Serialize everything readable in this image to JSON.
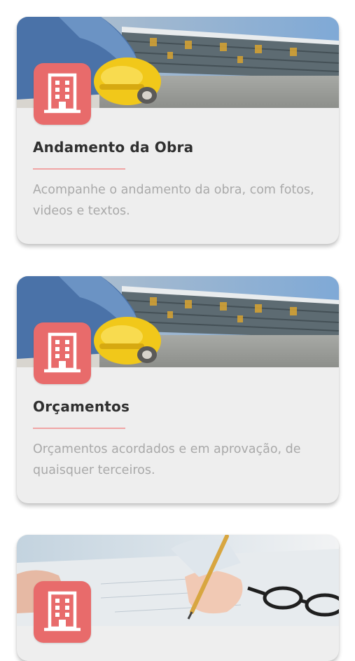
{
  "cards": [
    {
      "title": "Andamento da Obra",
      "description": "Acompanhe o andamento da obra, com fotos, videos e textos.",
      "image": "construction-worker-helmet-photo",
      "icon": "building-icon"
    },
    {
      "title": "Orçamentos",
      "description": "Orçamentos acordados e em aprovação, de quaisquer terceiros.",
      "image": "construction-worker-helmet-photo",
      "icon": "building-icon"
    },
    {
      "title": "",
      "description": "",
      "image": "hand-writing-on-blueprint-photo",
      "icon": "building-icon"
    }
  ],
  "colors": {
    "accent": "#e86b6b",
    "divider": "#f0a5a5",
    "card_bg": "#eeeeee",
    "title": "#2f2f2f",
    "description": "#a9a9a9"
  }
}
